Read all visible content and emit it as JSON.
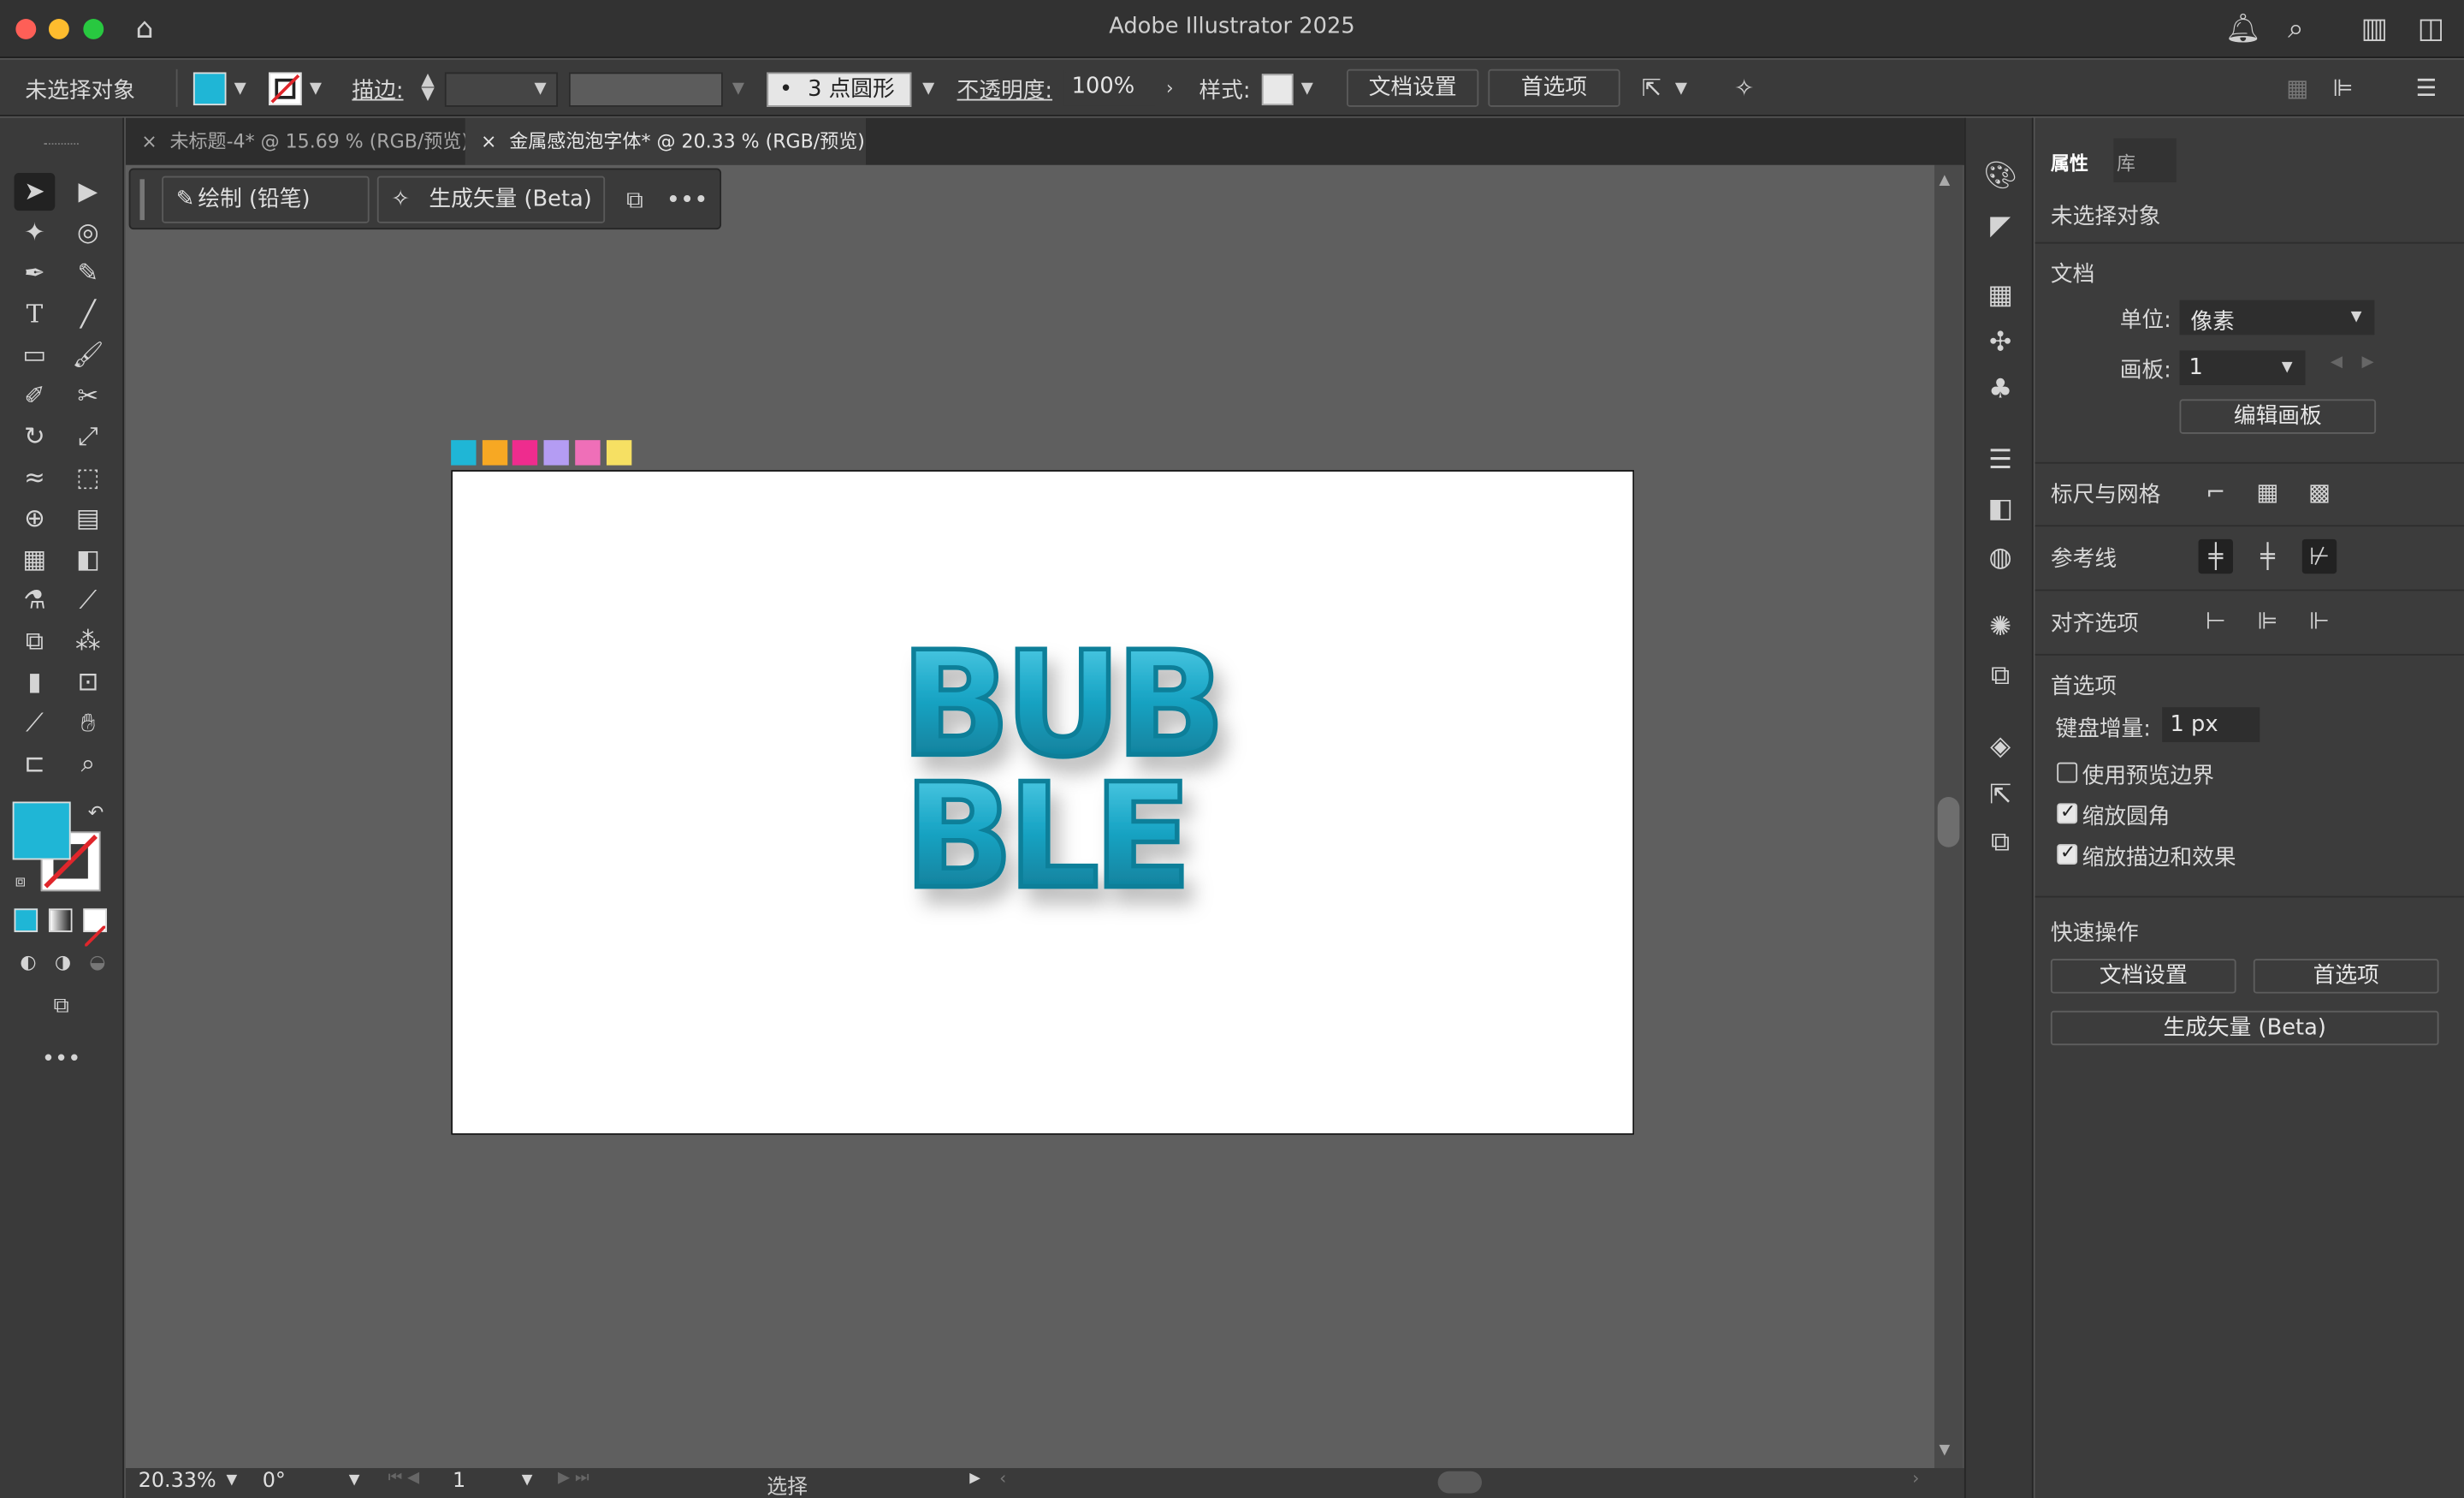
{
  "app": {
    "title": "Adobe Illustrator 2025"
  },
  "control_bar": {
    "selection_label": "未选择对象",
    "stroke_label": "描边:",
    "brush_label": "3 点圆形",
    "opacity_label": "不透明度:",
    "opacity_value": "100%",
    "style_label": "样式:",
    "doc_setup": "文档设置",
    "prefs": "首选项"
  },
  "tabs": [
    {
      "label": "未标题-4* @ 15.69 % (RGB/预览)"
    },
    {
      "label": "金属感泡泡字体* @ 20.33 % (RGB/预览)"
    }
  ],
  "float_bar": {
    "draw_label": "绘制 (铅笔)",
    "gen_label": "生成矢量 (Beta)"
  },
  "artwork": {
    "line1": "BUB",
    "line2": "BLE"
  },
  "status": {
    "zoom": "20.33%",
    "angle": "0°",
    "artboard": "1",
    "mode": "选择"
  },
  "panel": {
    "tab_properties": "属性",
    "tab_library": "库",
    "no_selection": "未选择对象",
    "document": "文档",
    "unit_label": "单位:",
    "unit_value": "像素",
    "artboard_label": "画板:",
    "artboard_value": "1",
    "edit_artboard": "编辑画板",
    "rulers_grids": "标尺与网格",
    "guides": "参考线",
    "align_options": "对齐选项",
    "preferences": "首选项",
    "keyboard_increment_label": "键盘增量:",
    "keyboard_increment_value": "1 px",
    "use_preview_bounds": "使用预览边界",
    "scale_corners": "缩放圆角",
    "scale_strokes": "缩放描边和效果",
    "quick_actions": "快速操作",
    "qa_doc_setup": "文档设置",
    "qa_prefs": "首选项",
    "qa_gen_vector": "生成矢量 (Beta)"
  },
  "colors": {
    "fill": "#1fb6d6",
    "swatches": [
      "#1fb6d6",
      "#f7a823",
      "#ee2c8e",
      "#b49cf3",
      "#ef6fb8",
      "#f6e063"
    ],
    "bubble": "#1aa6c6"
  }
}
